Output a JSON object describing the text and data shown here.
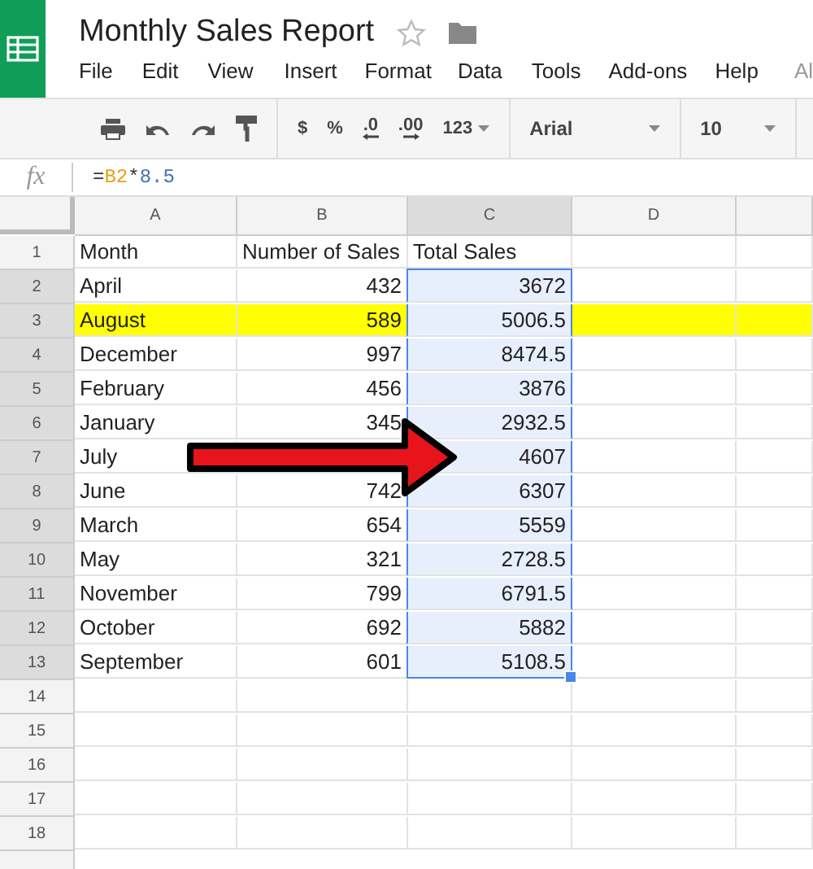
{
  "doc": {
    "title": "Monthly Sales Report",
    "starred": false
  },
  "menu": [
    "File",
    "Edit",
    "View",
    "Insert",
    "Format",
    "Data",
    "Tools",
    "Add-ons",
    "Help",
    "Al"
  ],
  "toolbar": {
    "currency": "$",
    "percent": "%",
    "decrease_decimals": ".0",
    "increase_decimals": ".00",
    "more_formats": "123",
    "font": "Arial",
    "font_size": "10"
  },
  "formula_bar": {
    "label": "fx",
    "parts": [
      {
        "text": "=",
        "kind": "op"
      },
      {
        "text": "B2",
        "kind": "ref"
      },
      {
        "text": "*",
        "kind": "op"
      },
      {
        "text": "8.5",
        "kind": "number"
      }
    ]
  },
  "columns": [
    {
      "label": "A",
      "numeric": false,
      "selected": false
    },
    {
      "label": "B",
      "numeric": true,
      "selected": false
    },
    {
      "label": "C",
      "numeric": true,
      "selected": true
    },
    {
      "label": "D",
      "numeric": false,
      "selected": false
    }
  ],
  "rows": [
    {
      "label": "1",
      "kind": "header",
      "selected": false,
      "highlighted": false,
      "cells": [
        "Month",
        "Number of Sales",
        "Total Sales",
        ""
      ]
    },
    {
      "label": "2",
      "kind": "data",
      "selected": true,
      "highlighted": false,
      "cells": [
        "April",
        "432",
        "3672",
        ""
      ]
    },
    {
      "label": "3",
      "kind": "data",
      "selected": true,
      "highlighted": true,
      "cells": [
        "August",
        "589",
        "5006.5",
        ""
      ]
    },
    {
      "label": "4",
      "kind": "data",
      "selected": true,
      "highlighted": false,
      "cells": [
        "December",
        "997",
        "8474.5",
        ""
      ]
    },
    {
      "label": "5",
      "kind": "data",
      "selected": true,
      "highlighted": false,
      "cells": [
        "February",
        "456",
        "3876",
        ""
      ]
    },
    {
      "label": "6",
      "kind": "data",
      "selected": true,
      "highlighted": false,
      "cells": [
        "January",
        "345",
        "2932.5",
        ""
      ]
    },
    {
      "label": "7",
      "kind": "data",
      "selected": true,
      "highlighted": false,
      "cells": [
        "July",
        "",
        "4607",
        ""
      ]
    },
    {
      "label": "8",
      "kind": "data",
      "selected": true,
      "highlighted": false,
      "cells": [
        "June",
        "742",
        "6307",
        ""
      ]
    },
    {
      "label": "9",
      "kind": "data",
      "selected": true,
      "highlighted": false,
      "cells": [
        "March",
        "654",
        "5559",
        ""
      ]
    },
    {
      "label": "10",
      "kind": "data",
      "selected": true,
      "highlighted": false,
      "cells": [
        "May",
        "321",
        "2728.5",
        ""
      ]
    },
    {
      "label": "11",
      "kind": "data",
      "selected": true,
      "highlighted": false,
      "cells": [
        "November",
        "799",
        "6791.5",
        ""
      ]
    },
    {
      "label": "12",
      "kind": "data",
      "selected": true,
      "highlighted": false,
      "cells": [
        "October",
        "692",
        "5882",
        ""
      ]
    },
    {
      "label": "13",
      "kind": "data",
      "selected": true,
      "highlighted": false,
      "cells": [
        "September",
        "601",
        "5108.5",
        ""
      ]
    },
    {
      "label": "14",
      "kind": "data",
      "selected": false,
      "highlighted": false,
      "cells": [
        "",
        "",
        "",
        ""
      ]
    },
    {
      "label": "15",
      "kind": "data",
      "selected": false,
      "highlighted": false,
      "cells": [
        "",
        "",
        "",
        ""
      ]
    },
    {
      "label": "16",
      "kind": "data",
      "selected": false,
      "highlighted": false,
      "cells": [
        "",
        "",
        "",
        ""
      ]
    },
    {
      "label": "17",
      "kind": "data",
      "selected": false,
      "highlighted": false,
      "cells": [
        "",
        "",
        "",
        ""
      ]
    },
    {
      "label": "18",
      "kind": "data",
      "selected": false,
      "highlighted": false,
      "cells": [
        "",
        "",
        "",
        ""
      ]
    }
  ]
}
